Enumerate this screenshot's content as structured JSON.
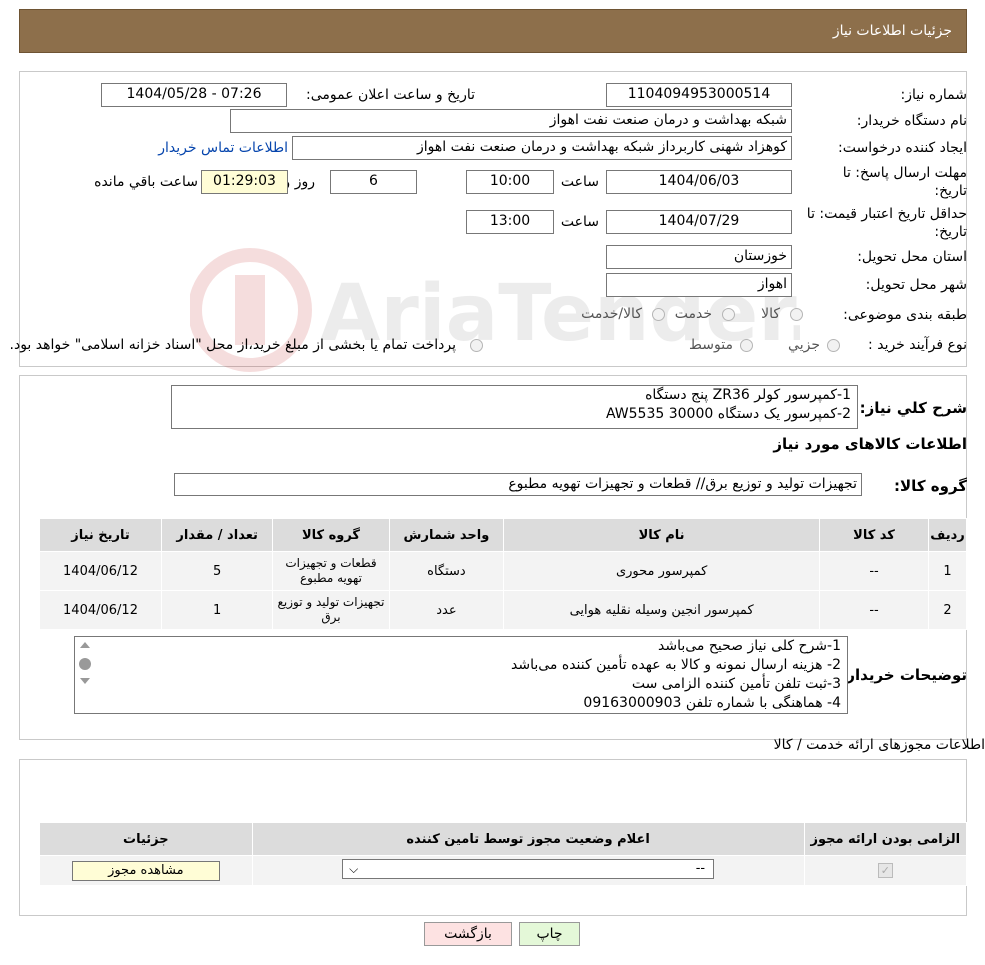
{
  "header": {
    "title": "جزئیات اطلاعات نیاز"
  },
  "info": {
    "need_number_label": "شماره نیاز:",
    "need_number": "1104094953000514",
    "announce_label": "تاریخ و ساعت اعلان عمومی:",
    "announce_value": "1404/05/28 - 07:26",
    "buyer_org_label": "نام دستگاه خریدار:",
    "buyer_org": "شبکه بهداشت و درمان صنعت نفت اهواز",
    "creator_label": "ایجاد کننده درخواست:",
    "creator": "کوهزاد شهنی کاربرداز شبکه بهداشت و درمان صنعت نفت اهواز",
    "contact_link": "اطلاعات تماس خریدار",
    "deadline_label_1": "مهلت ارسال پاسخ: تا",
    "deadline_label_2": "تاریخ:",
    "deadline_date": "1404/06/03",
    "time_label": "ساعت",
    "deadline_time": "10:00",
    "days_value": "6",
    "days_label": "روز و",
    "remaining_time": "01:29:03",
    "remaining_label": "ساعت باقي مانده",
    "validity_label_1": "حداقل تاریخ اعتبار قیمت: تا",
    "validity_label_2": "تاریخ:",
    "validity_date": "1404/07/29",
    "validity_time": "13:00",
    "province_label": "استان محل تحویل:",
    "province": "خوزستان",
    "city_label": "شهر محل تحویل:",
    "city": "اهواز",
    "category_label": "طبقه بندی موضوعی:",
    "category_options": [
      "کالا",
      "خدمت",
      "کالا/خدمت"
    ],
    "process_label": "نوع فرآیند خرید :",
    "process_options": [
      "جزیي",
      "متوسط"
    ],
    "process_note": "پرداخت تمام یا بخشی از مبلغ خرید،از محل \"اسناد خزانه اسلامی\" خواهد بود."
  },
  "summary": {
    "label": "شرح کلي نیاز:",
    "line1": "1-کمپرسور کولر ZR36 پنج دستگاه",
    "line2": "2-کمپرسور   یک دستگاه  30000 AW5535"
  },
  "goods_title": "اطلاعات کالاهای مورد نیاز",
  "goods_group": {
    "label": "گروه کالا:",
    "value": "تجهیزات تولید و توزیع برق//  قطعات و تجهیزات تهویه مطبوع"
  },
  "goods_table": {
    "headers": [
      "ردیف",
      "کد کالا",
      "نام کالا",
      "واحد شمارش",
      "گروه کالا",
      "تعداد / مقدار",
      "تاریخ نیاز"
    ],
    "rows": [
      [
        "1",
        "--",
        "کمپرسور محوری",
        "دستگاه",
        "قطعات و تجهیزات تهویه مطبوع",
        "5",
        "1404/06/12"
      ],
      [
        "2",
        "--",
        "کمپرسور انجین وسیله نقلیه هوایی",
        "عدد",
        "تجهیزات تولید و توزیع برق",
        "1",
        "1404/06/12"
      ]
    ]
  },
  "buyer_notes": {
    "label": "توضیحات خریدار:",
    "lines": [
      "1-شرح کلی نیاز صحیح می‌باشد",
      "2- هزینه ارسال نمونه و کالا به عهده تأمین کننده می‌باشد",
      "3-ثبت تلفن تأمین کننده الزامی ست",
      "4- هماهنگی با شماره تلفن 09163000903"
    ]
  },
  "permits": {
    "title": "اطلاعات مجوزهای ارائه خدمت / کالا",
    "headers": [
      "الزامی بودن ارائه مجوز",
      "اعلام وضعیت مجوز توسط تامین کننده",
      "جزئیات"
    ],
    "select_value": "--",
    "view_button": "مشاهده مجوز"
  },
  "footer": {
    "back_button": "بازگشت",
    "print_button": "چاپ"
  },
  "watermark": "AriaTender.neT",
  "colors": {
    "header_bg": "#8d6f4b",
    "link": "#0645ad",
    "back_bg": "#fde2e2",
    "print_bg": "#e4f8d8"
  }
}
